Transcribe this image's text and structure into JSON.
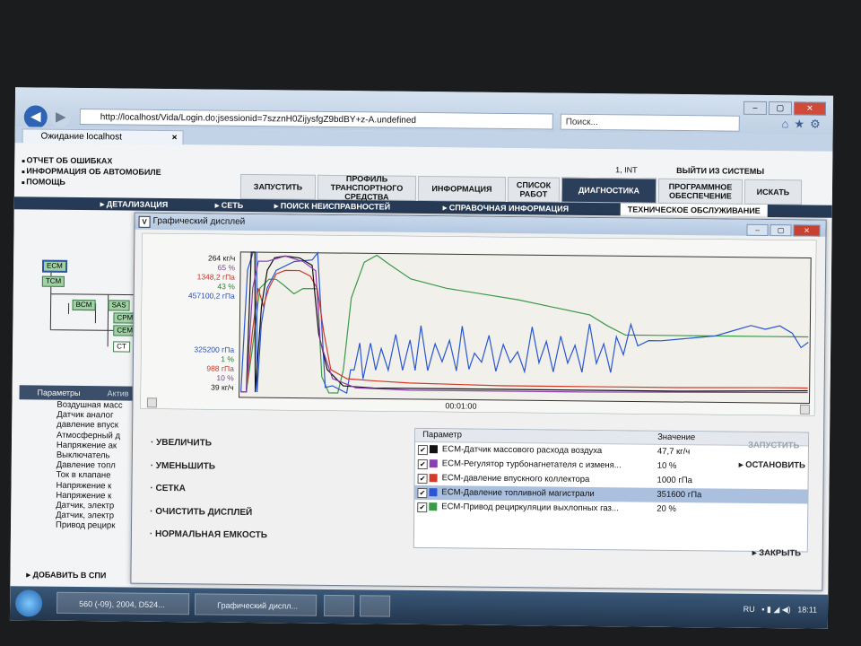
{
  "browser": {
    "address": "http://localhost/Vida/Login.do;jsessionid=7szznH0ZijysfgZ9bdBY+z-A.undefined",
    "search_placeholder": "Поиск...",
    "tab_title": "Ожидание localhost"
  },
  "vida": {
    "menu": [
      "ОТЧЕТ ОБ ОШИБКАХ",
      "ИНФОРМАЦИЯ ОБ АВТОМОБИЛЕ",
      "ПОМОЩЬ"
    ],
    "login_info": "1, INT",
    "logout": "ВЫЙТИ ИЗ СИСТЕМЫ",
    "main_tabs": [
      "ЗАПУСТИТЬ",
      "ПРОФИЛЬ ТРАНСПОРТНОГО СРЕДСТВА",
      "ИНФОРМАЦИЯ",
      "СПИСОК РАБОТ",
      "ДИАГНОСТИКА",
      "ПРОГРАММНОЕ ОБЕСПЕЧЕНИЕ",
      "ИСКАТЬ"
    ],
    "active_tab": "ДИАГНОСТИКА",
    "sub_nav": [
      "ДЕТАЛИЗАЦИЯ",
      "СЕТЬ",
      "ПОИСК НЕИСПРАВНОСТЕЙ",
      "СПРАВОЧНАЯ ИНФОРМАЦИЯ",
      "ТЕХНИЧЕСКОЕ ОБСЛУЖИВАНИЕ"
    ],
    "diagram_nodes": [
      "ECM",
      "TCM",
      "BCM",
      "SAS",
      "CPM",
      "CEM",
      "CT"
    ],
    "param_tabs": [
      "Параметры",
      "Актив"
    ],
    "param_list": [
      "Воздушная масс",
      "Датчик аналог",
      "давление впуск",
      "Атмосферный д",
      "Напряжение ак",
      "Выключатель",
      "Давление топл",
      "Ток в клапане",
      "Напряжение к",
      "Напряжение к",
      "Датчик, электр",
      "Датчик, электр",
      "Привод рецирк"
    ],
    "add_button": "ДОБАВИТЬ В СПИ"
  },
  "dialog": {
    "title": "Графический дисплей",
    "axis_labels_top": [
      {
        "text": "264 кг/ч",
        "color": "#111111"
      },
      {
        "text": "65 %",
        "color": "#7a4a8a"
      },
      {
        "text": "1348,2 гПа",
        "color": "#c23a2a"
      },
      {
        "text": "43 %",
        "color": "#2f7a3a"
      },
      {
        "text": "457100,2 гПа",
        "color": "#2a4fc0"
      }
    ],
    "axis_labels_bottom": [
      {
        "text": "325200 гПа",
        "color": "#2a4fc0"
      },
      {
        "text": "1 %",
        "color": "#2f7a3a"
      },
      {
        "text": "988 гПа",
        "color": "#c23a2a"
      },
      {
        "text": "10 %",
        "color": "#7a4a8a"
      },
      {
        "text": "39 кг/ч",
        "color": "#111111"
      }
    ],
    "time_label": "00:01:00",
    "actions": [
      "УВЕЛИЧИТЬ",
      "УМЕНЬШИТЬ",
      "СЕТКА",
      "ОЧИСТИТЬ ДИСПЛЕЙ",
      "НОРМАЛЬНАЯ ЕМКОСТЬ"
    ],
    "table_headers": {
      "param": "Параметр",
      "value": "Значение"
    },
    "params": [
      {
        "name": "ECM-Датчик массового расхода воздуха",
        "value": "47,7 кг/ч",
        "color": "#111111",
        "selected": false
      },
      {
        "name": "ECM-Регулятор турбонагнетателя с изменя...",
        "value": "10 %",
        "color": "#8a3fb0",
        "selected": false
      },
      {
        "name": "ECM-давление впускного коллектора",
        "value": "1000 гПа",
        "color": "#d23a2a",
        "selected": false
      },
      {
        "name": "ECM-Давление топливной магистрали",
        "value": "351600 гПа",
        "color": "#2a56d0",
        "selected": true
      },
      {
        "name": "ECM-Привод рециркуляции выхлопных газ...",
        "value": "20 %",
        "color": "#3a9a4a",
        "selected": false
      }
    ],
    "start": "ЗАПУСТИТЬ",
    "stop": "ОСТАНОВИТЬ",
    "close": "ЗАКРЫТЬ"
  },
  "taskbar": {
    "items": [
      "560 (-09), 2004, D524...",
      "Графический диспл...",
      "",
      ""
    ],
    "lang": "RU",
    "clock": "18:11"
  }
}
